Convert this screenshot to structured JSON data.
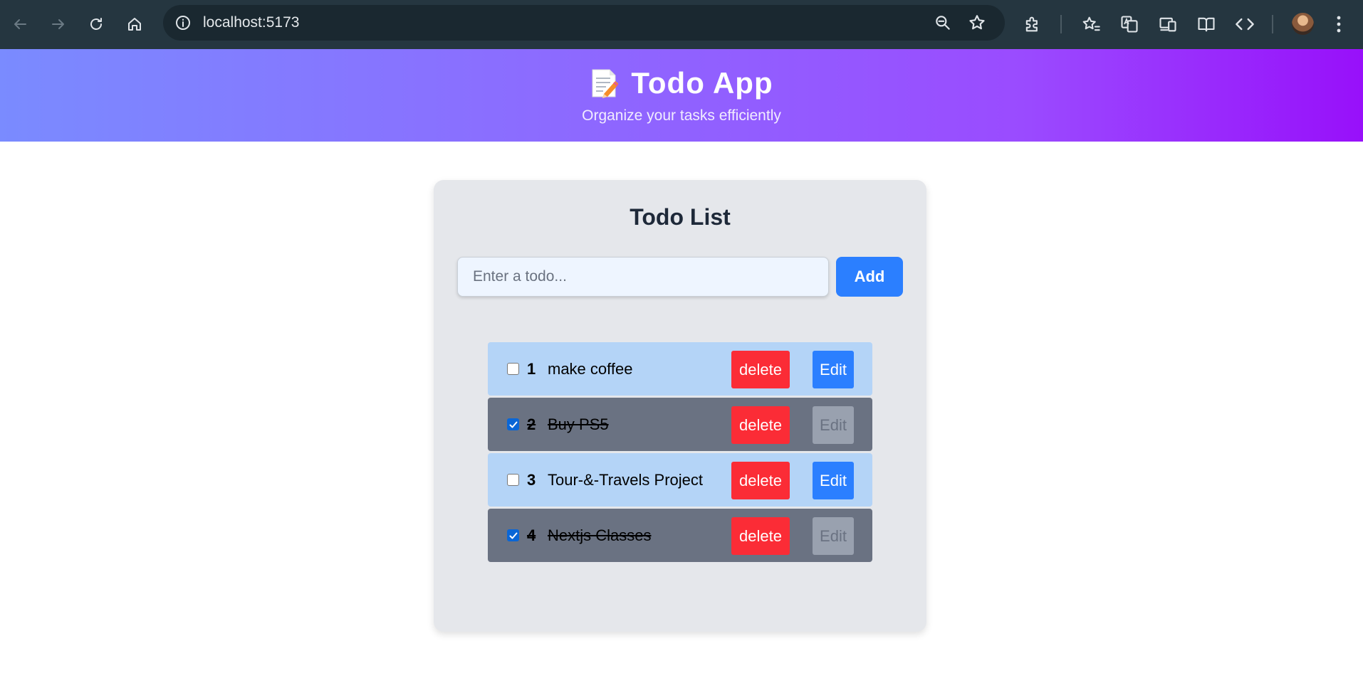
{
  "browser": {
    "url": "localhost:5173"
  },
  "header": {
    "title": "Todo App",
    "subtitle": "Organize your tasks efficiently",
    "gradient_start": "#7a8bff",
    "gradient_end": "#9810fa"
  },
  "card": {
    "title": "Todo List",
    "input_placeholder": "Enter a todo...",
    "input_value": "",
    "add_label": "Add"
  },
  "todos": [
    {
      "number": "1",
      "text": "make coffee",
      "completed": true,
      "delete_label": "delete",
      "edit_label": "Edit"
    },
    {
      "number": "2",
      "text": "Buy PS5",
      "completed": true,
      "delete_label": "delete",
      "edit_label": "Edit"
    },
    {
      "number": "3",
      "text": "Tour-&-Travels Project",
      "completed": false,
      "delete_label": "delete",
      "edit_label": "Edit"
    },
    {
      "number": "4",
      "text": "Nextjs Classes",
      "completed": true,
      "delete_label": "delete",
      "edit_label": "Edit"
    }
  ],
  "colors": {
    "delete": "#fb2c36",
    "primary": "#2b7fff",
    "pending_row": "#b4d4f7",
    "done_row": "#6a7282"
  }
}
